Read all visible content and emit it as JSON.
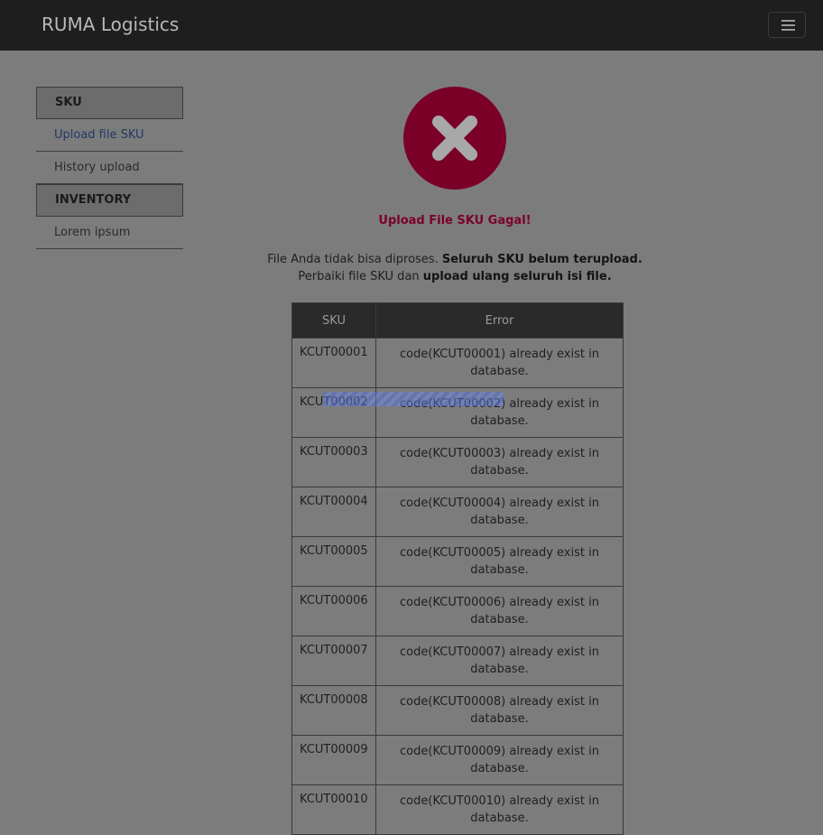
{
  "navbar": {
    "brand": "RUMA Logistics",
    "menu_icon": "hamburger-icon"
  },
  "sidebar": {
    "sections": [
      {
        "heading": "SKU",
        "items": [
          {
            "label": "Upload file SKU",
            "active": true
          },
          {
            "label": "History upload",
            "active": false
          }
        ]
      },
      {
        "heading": "INVENTORY",
        "items": [
          {
            "label": "Lorem ipsum",
            "active": false
          }
        ]
      }
    ]
  },
  "main": {
    "status_icon": "close-circle-icon",
    "title": "Upload File SKU Gagal!",
    "message": {
      "line1_plain": "File Anda tidak bisa diproses. ",
      "line1_bold": "Seluruh SKU belum terupload.",
      "line2_plain": "Perbaiki file SKU dan ",
      "line2_bold": "upload ulang seluruh isi file."
    },
    "table": {
      "headers": [
        "SKU",
        "Error"
      ],
      "rows": [
        {
          "sku": "KCUT00001",
          "error": "code(KCUT00001) already exist in database."
        },
        {
          "sku": "KCUT00002",
          "error": "code(KCUT00002) already exist in database."
        },
        {
          "sku": "KCUT00003",
          "error": "code(KCUT00003) already exist in database."
        },
        {
          "sku": "KCUT00004",
          "error": "code(KCUT00004) already exist in database."
        },
        {
          "sku": "KCUT00005",
          "error": "code(KCUT00005) already exist in database."
        },
        {
          "sku": "KCUT00006",
          "error": "code(KCUT00006) already exist in database."
        },
        {
          "sku": "KCUT00007",
          "error": "code(KCUT00007) already exist in database."
        },
        {
          "sku": "KCUT00008",
          "error": "code(KCUT00008) already exist in database."
        },
        {
          "sku": "KCUT00009",
          "error": "code(KCUT00009) already exist in database."
        },
        {
          "sku": "KCUT00010",
          "error": "code(KCUT00010) already exist in database."
        }
      ]
    }
  },
  "colors": {
    "navbar": "#1e1e1e",
    "overlay": "#7c7c7c",
    "error_red": "#7a0028",
    "link": "#233a64"
  }
}
